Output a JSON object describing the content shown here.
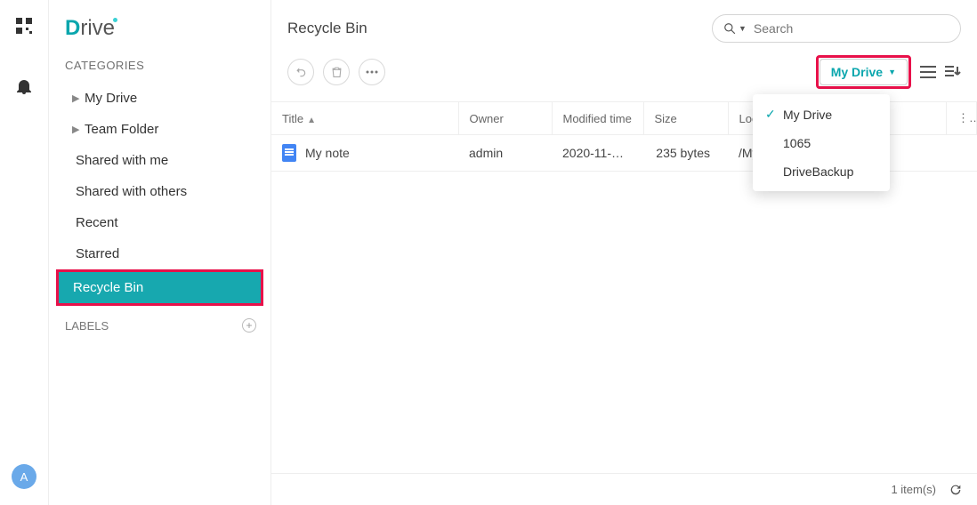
{
  "rail": {
    "avatar_initial": "A"
  },
  "logo": {
    "text_after_d": "rive"
  },
  "sidebar": {
    "categories_label": "CATEGORIES",
    "labels_label": "LABELS",
    "items": [
      {
        "label": "My Drive"
      },
      {
        "label": "Team Folder"
      },
      {
        "label": "Shared with me"
      },
      {
        "label": "Shared with others"
      },
      {
        "label": "Recent"
      },
      {
        "label": "Starred"
      },
      {
        "label": "Recycle Bin"
      }
    ]
  },
  "header": {
    "title": "Recycle Bin",
    "search_placeholder": "Search"
  },
  "toolbar": {
    "drive_button_label": "My Drive",
    "dropdown": [
      {
        "label": "My Drive",
        "checked": true
      },
      {
        "label": "1065",
        "checked": false
      },
      {
        "label": "DriveBackup",
        "checked": false
      }
    ]
  },
  "table": {
    "columns": {
      "title": "Title",
      "owner": "Owner",
      "modified": "Modified time",
      "size": "Size",
      "location": "Location"
    },
    "rows": [
      {
        "title": "My note",
        "owner": "admin",
        "modified": "2020-11-…",
        "size": "235 bytes",
        "location": "/My Drive/My…"
      }
    ]
  },
  "footer": {
    "count_label": "1 item(s)"
  }
}
